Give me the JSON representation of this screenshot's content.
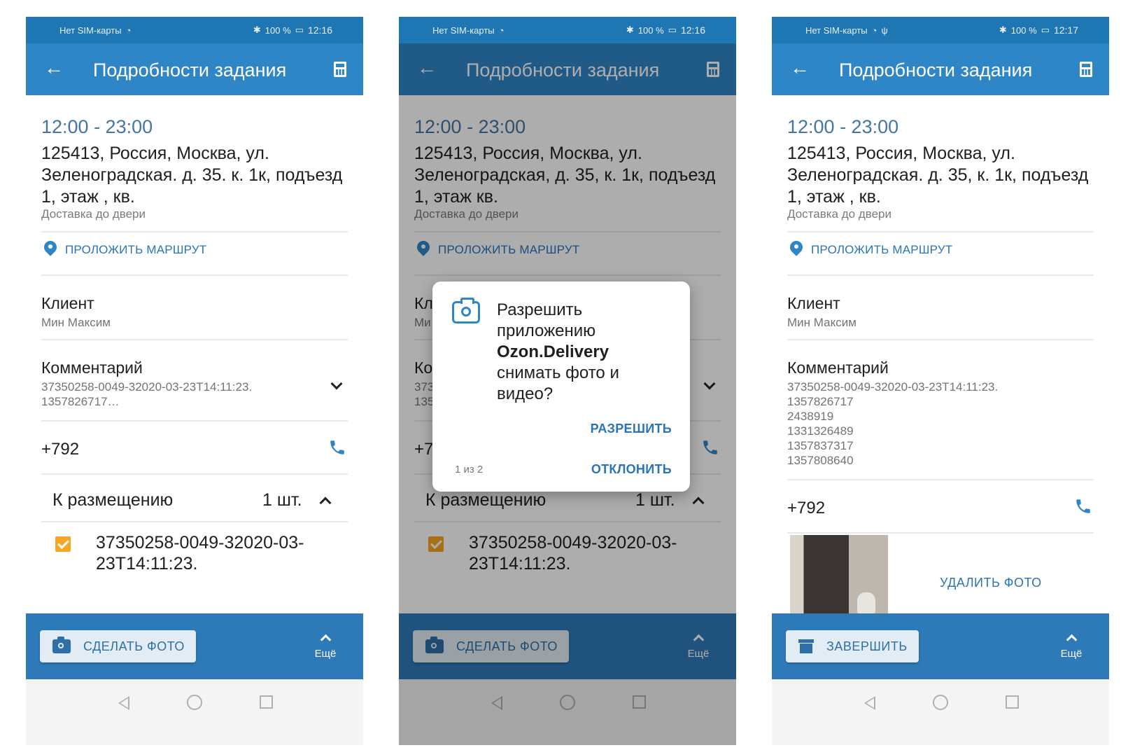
{
  "screens": [
    {
      "status": {
        "sim": "Нет SIM-карты",
        "battery": "100 %",
        "time": "12:16"
      },
      "header": {
        "title": "Подробности задания"
      },
      "task": {
        "time_range": "12:00 - 23:00",
        "address": "125413, Россия, Москва, ул. Зеленоградская. д. 35. к. 1к, подъезд 1, этаж , кв.",
        "delivery_type": "Доставка до двери",
        "route_label": "ПРОЛОЖИТЬ МАРШРУТ",
        "client_label": "Клиент",
        "client_name": "Мин Максим",
        "comment_label": "Комментарий",
        "comment_line1": "37350258-0049-32020-03-23T14:11:23.",
        "comment_line2": "1357826717…",
        "phone": "+792",
        "group_label": "К размещению",
        "group_count": "1 шт.",
        "item_text": "37350258-0049-32020-03-23T14:11:23."
      },
      "bottom": {
        "action_label": "СДЕЛАТЬ ФОТО",
        "more_label": "Ещё"
      }
    },
    {
      "status": {
        "sim": "Нет SIM-карты",
        "battery": "100 %",
        "time": "12:16"
      },
      "header": {
        "title": "Подробности задания"
      },
      "task": {
        "time_range": "12:00 - 23:00",
        "address": "125413, Россия, Москва, ул. Зеленоградская, д. 35, к. 1к, подъезд 1, этаж кв.",
        "delivery_type": "Доставка до двери",
        "route_label": "ПРОЛОЖИТЬ МАРШРУТ",
        "client_label": "Кл",
        "client_name": "Ми",
        "comment_label": "Ко",
        "comment_line1": "373",
        "comment_line2": "135",
        "phone": "+7",
        "group_label": "К размещению",
        "group_count": "1 шт.",
        "item_text": "37350258-0049-32020-03-23T14:11:23."
      },
      "dialog": {
        "msg_line1": "Разрешить приложению",
        "app_name": "Ozon.Delivery",
        "msg_line2": "снимать фото и видео?",
        "allow": "РАЗРЕШИТЬ",
        "deny": "ОТКЛОНИТЬ",
        "pager": "1 из 2"
      },
      "bottom": {
        "action_label": "СДЕЛАТЬ ФОТО",
        "more_label": "Ещё"
      }
    },
    {
      "status": {
        "sim": "Нет SIM-карты",
        "battery": "100 %",
        "time": "12:17"
      },
      "header": {
        "title": "Подробности задания"
      },
      "task": {
        "time_range": "12:00 - 23:00",
        "address": "125413, Россия, Москва, ул. Зеленоградская. д. 35, к. 1к, подъезд 1, этаж , кв.",
        "delivery_type": "Доставка до двери",
        "route_label": "ПРОЛОЖИТЬ МАРШРУТ",
        "client_label": "Клиент",
        "client_name": "Мин Максим",
        "comment_label": "Комментарий",
        "comment_lines": [
          "37350258-0049-32020-03-23T14:11:23.",
          "1357826717",
          "2438919",
          "1331326489",
          "1357837317",
          "1357808640"
        ],
        "phone": "+792",
        "delete_photo": "УДАЛИТЬ ФОТО"
      },
      "bottom": {
        "action_label": "ЗАВЕРШИТЬ",
        "more_label": "Ещё"
      }
    }
  ]
}
